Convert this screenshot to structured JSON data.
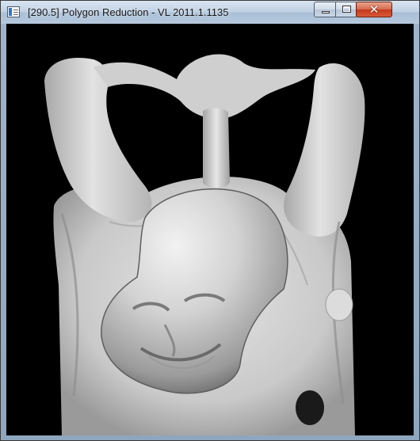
{
  "window": {
    "title": "[290.5] Polygon Reduction - VL 2011.1.1135",
    "controls": {
      "minimize": "minimize",
      "maximize": "maximize",
      "close": "✕"
    }
  },
  "viewport": {
    "background_color": "#000000",
    "model_color": "#d6d6d6",
    "content": "rendered 3D model (laughing Buddha statue, arms raised)"
  }
}
